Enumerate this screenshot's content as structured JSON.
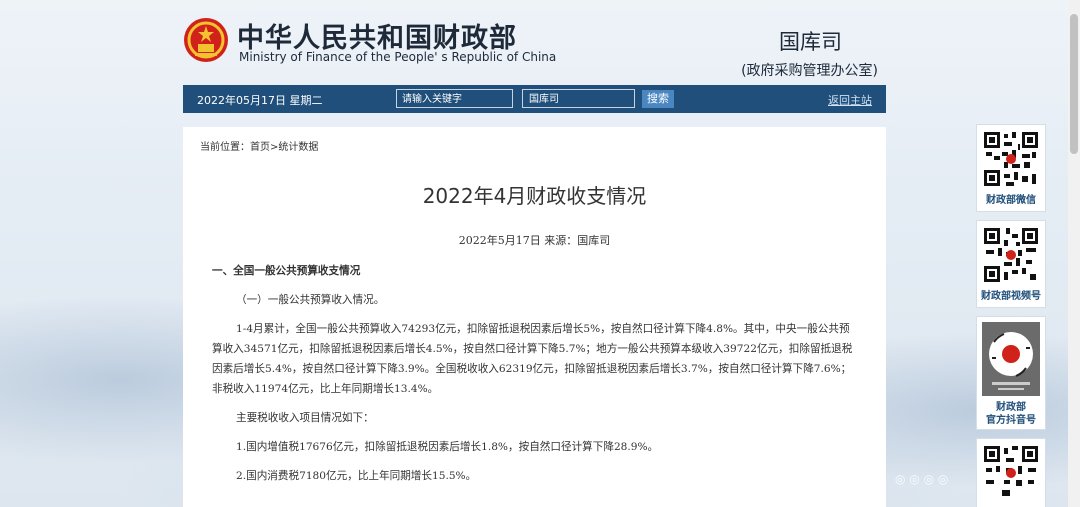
{
  "header": {
    "title_cn": "中华人民共和国财政部",
    "title_en": "Ministry of Finance of the People' s Republic of China",
    "dept": "国库司",
    "dept_sub": "(政府采购管理办公室)"
  },
  "navbar": {
    "date": "2022年05月17日 星期二",
    "keyword_placeholder": "请输入关键字",
    "scope_value": "国库司",
    "search_label": "搜索",
    "back_label": "返回主站"
  },
  "breadcrumb": "当前位置：首页>统计数据",
  "article": {
    "title": "2022年4月财政收支情况",
    "meta": "2022年5月17日 来源：国库司",
    "section1": "一、全国一般公共预算收支情况",
    "sub1": "（一）一般公共预算收入情况。",
    "para1": "1-4月累计，全国一般公共预算收入74293亿元，扣除留抵退税因素后增长5%，按自然口径计算下降4.8%。其中，中央一般公共预算收入34571亿元，扣除留抵退税因素后增长4.5%，按自然口径计算下降5.7%；地方一般公共预算本级收入39722亿元，扣除留抵退税因素后增长5.4%，按自然口径计算下降3.9%。全国税收收入62319亿元，扣除留抵退税因素后增长3.7%，按自然口径计算下降7.6%；非税收入11974亿元，比上年同期增长13.4%。",
    "para2": "主要税收收入项目情况如下：",
    "item1": "1.国内增值税17676亿元，扣除留抵退税因素后增长1.8%，按自然口径计算下降28.9%。",
    "item2": "2.国内消费税7180亿元，比上年同期增长15.5%。"
  },
  "side": {
    "wechat_label": "财政部微信",
    "video_label": "财政部视频号",
    "douyin_label1": "财政部",
    "douyin_label2": "官方抖音号"
  },
  "colors": {
    "nav_bg": "#1f4f7a",
    "search_bg": "#4a86bf",
    "emblem_red": "#d0221a"
  }
}
